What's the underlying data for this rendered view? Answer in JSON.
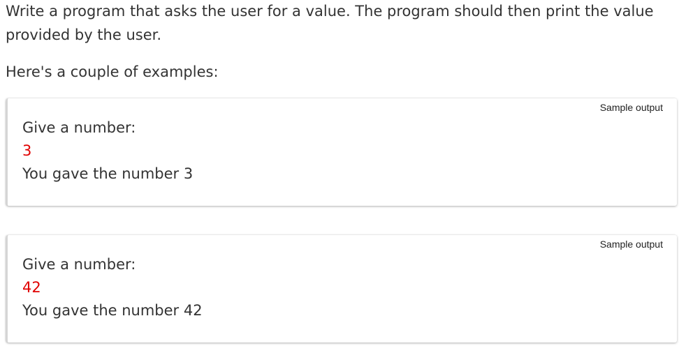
{
  "intro": {
    "paragraph": "Write a program that asks the user for a value. The program should then print the value provided by the user.",
    "examples_lead": "Here's a couple of examples:"
  },
  "samples": [
    {
      "title": "Sample output",
      "lines": [
        {
          "text": "Give a number:",
          "kind": "output"
        },
        {
          "text": "3",
          "kind": "input"
        },
        {
          "text": "You gave the number 3",
          "kind": "output"
        }
      ]
    },
    {
      "title": "Sample output",
      "lines": [
        {
          "text": "Give a number:",
          "kind": "output"
        },
        {
          "text": "42",
          "kind": "input"
        },
        {
          "text": "You gave the number 42",
          "kind": "output"
        }
      ]
    }
  ],
  "colors": {
    "text": "#333333",
    "user_input": "#e00000",
    "card_background": "#ffffff"
  }
}
